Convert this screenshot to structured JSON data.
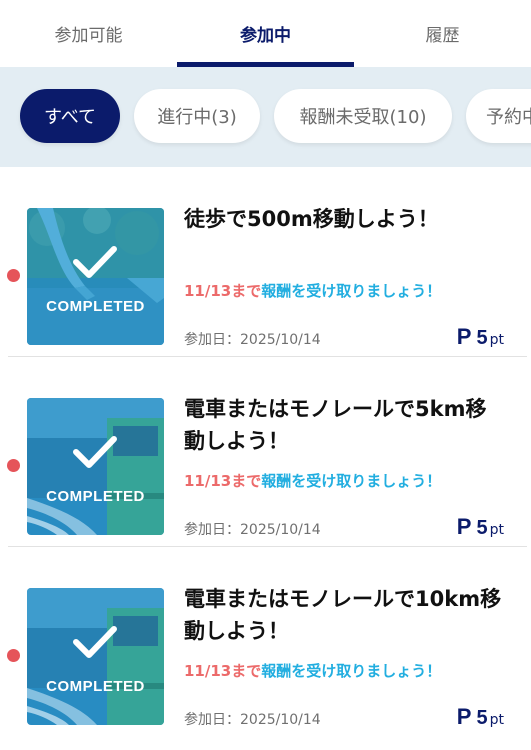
{
  "tabs": [
    {
      "label": "参加可能"
    },
    {
      "label": "参加中"
    },
    {
      "label": "履歴"
    }
  ],
  "filters": [
    {
      "label": "すべて"
    },
    {
      "label": "進行中(3)"
    },
    {
      "label": "報酬未受取(10)"
    },
    {
      "label": "予約中"
    }
  ],
  "missions": [
    {
      "title": "徒歩で500m移動しよう！",
      "badge": "COMPLETED",
      "deadline": "11/13まで",
      "reward_message": "報酬を受け取りましょう！",
      "joined": "参加日：2025/10/14",
      "points": "5",
      "points_unit": "pt",
      "thumbnail": "walking-photo"
    },
    {
      "title": "電車またはモノレールで5km移動しよう！",
      "badge": "COMPLETED",
      "deadline": "11/13まで",
      "reward_message": "報酬を受け取りましょう！",
      "joined": "参加日：2025/10/14",
      "points": "5",
      "points_unit": "pt",
      "thumbnail": "train-photo"
    },
    {
      "title": "電車またはモノレールで10km移動しよう！",
      "badge": "COMPLETED",
      "deadline": "11/13まで",
      "reward_message": "報酬を受け取りましょう！",
      "joined": "参加日：2025/10/14",
      "points": "5",
      "points_unit": "pt",
      "thumbnail": "train-photo"
    }
  ],
  "colors": {
    "brand_navy": "#0b1b6b",
    "deadline_red": "#ec6a6a",
    "reward_blue": "#22aee0",
    "unread_dot": "#e5545a",
    "filter_band": "#e3edf3"
  }
}
